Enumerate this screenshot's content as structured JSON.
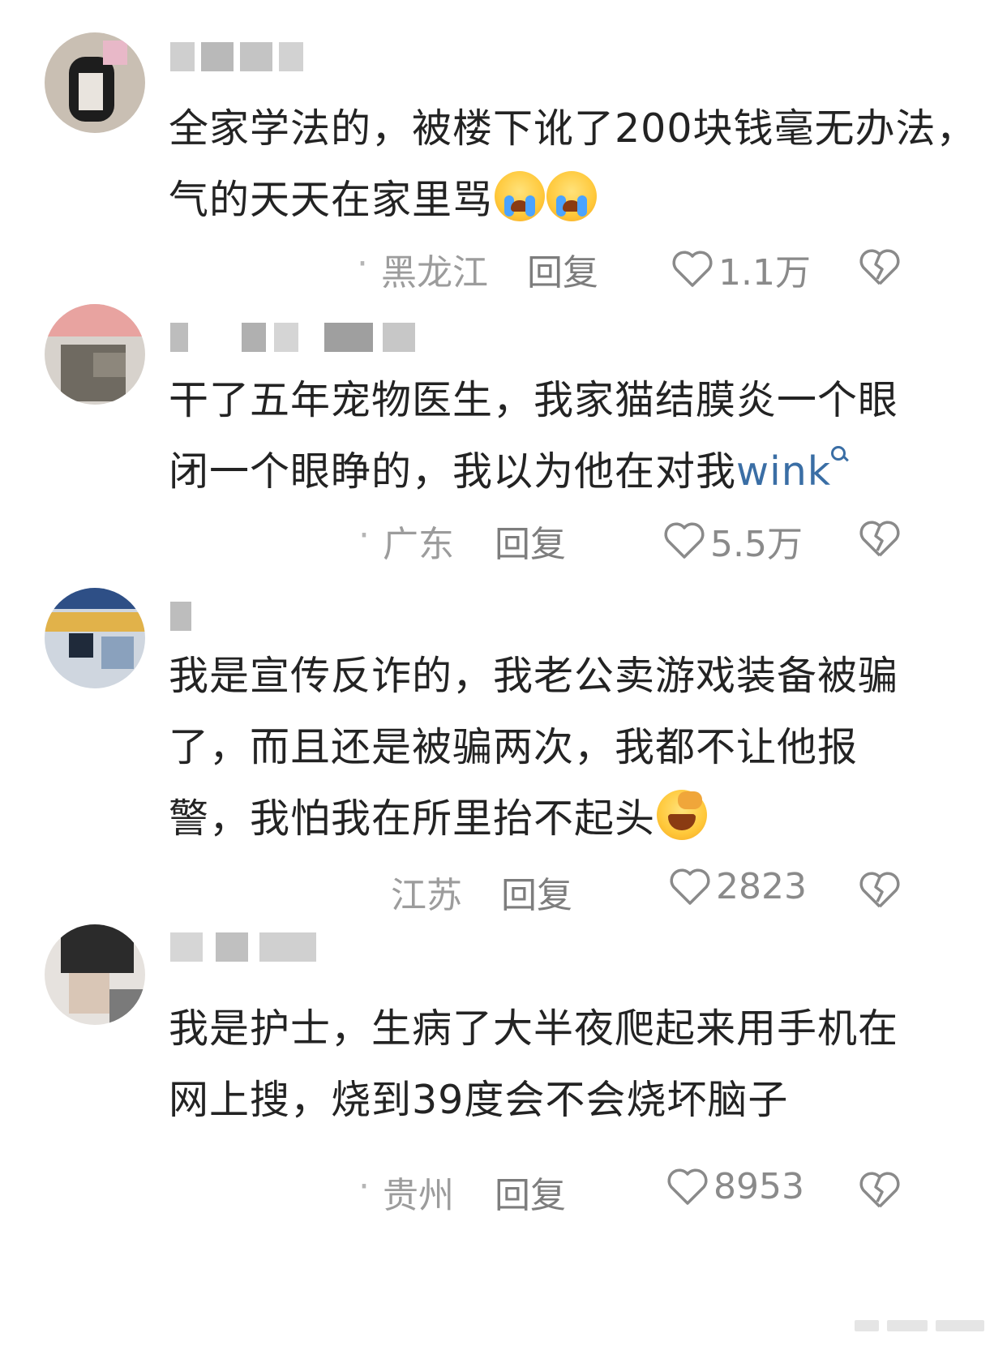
{
  "comments": [
    {
      "text_before": "全家学法的，被楼下讹了200块钱毫无办法，气的天天在家里骂",
      "emojis": [
        "crying-face",
        "crying-face"
      ],
      "location": "黑龙江",
      "reply_label": "回复",
      "likes": "1.1万"
    },
    {
      "text_before": "干了五年宠物医生，我家猫结膜炎一个眼闭一个眼睁的，我以为他在对我",
      "link_text": "wink",
      "location": "广东",
      "reply_label": "回复",
      "likes": "5.5万"
    },
    {
      "text_before": "我是宣传反诈的，我老公卖游戏装备被骗了，而且还是被骗两次，我都不让他报警，我怕我在所里抬不起头",
      "emojis": [
        "laughing-face"
      ],
      "location": "江苏",
      "reply_label": "回复",
      "likes": "2823"
    },
    {
      "text_before": "我是护士，生病了大半夜爬起来用手机在网上搜，烧到39度会不会烧坏脑子",
      "location": "贵州",
      "reply_label": "回复",
      "likes": "8953"
    }
  ],
  "icons": {
    "like": "heart-icon",
    "dislike": "broken-heart-icon",
    "search": "search-icon"
  },
  "colors": {
    "text": "#232323",
    "meta": "#9a9a9a",
    "link": "#3a6ea5"
  }
}
